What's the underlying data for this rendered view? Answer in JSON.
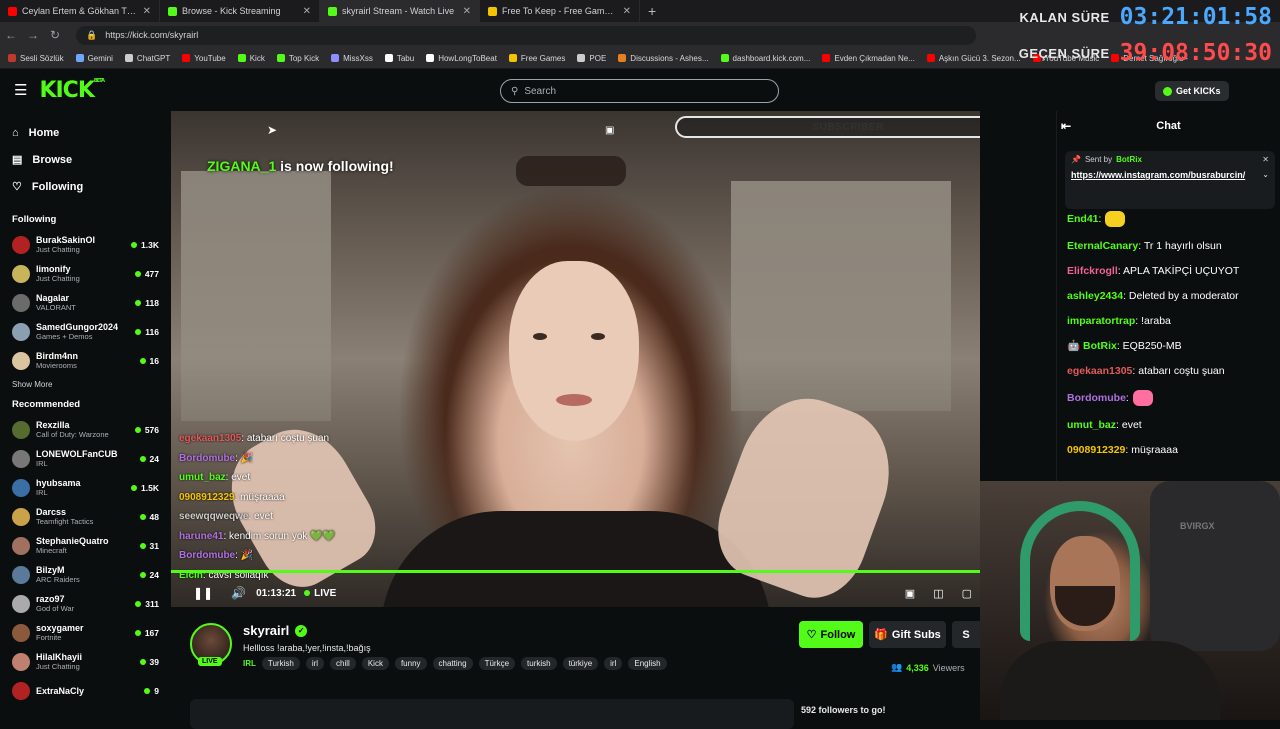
{
  "browser": {
    "tabs": [
      {
        "title": "Ceylan Ertem & Gökhan Türkmen",
        "icon_color": "#ff0000",
        "active": false
      },
      {
        "title": "Browse - Kick Streaming",
        "icon_color": "#53fc18",
        "active": false
      },
      {
        "title": "skyrairl Stream - Watch Live",
        "icon_color": "#53fc18",
        "active": true
      },
      {
        "title": "Free To Keep - Free Games, Every",
        "icon_color": "#f5c400",
        "active": false
      }
    ],
    "url": "https://kick.com/skyrairl",
    "bookmarks": [
      {
        "label": "Sesli Sözlük",
        "color": "#c0392b"
      },
      {
        "label": "Gemini",
        "color": "#6ea8ff"
      },
      {
        "label": "ChatGPT",
        "color": "#cccccc"
      },
      {
        "label": "YouTube",
        "color": "#ff0000"
      },
      {
        "label": "Kick",
        "color": "#53fc18"
      },
      {
        "label": "Top Kick",
        "color": "#53fc18"
      },
      {
        "label": "MissXss",
        "color": "#8e8eff"
      },
      {
        "label": "Tabu",
        "color": "#ffffff"
      },
      {
        "label": "HowLongToBeat",
        "color": "#ffffff"
      },
      {
        "label": "Free Games",
        "color": "#f5c400"
      },
      {
        "label": "POE",
        "color": "#cccccc"
      },
      {
        "label": "Discussions - Ashes...",
        "color": "#e67e22"
      },
      {
        "label": "dashboard.kick.com...",
        "color": "#53fc18"
      },
      {
        "label": "Evden Çıkmadan Ne...",
        "color": "#ff0000"
      },
      {
        "label": "Aşkın Gücü 3. Sezon...",
        "color": "#ff0000"
      },
      {
        "label": "YouTube Music",
        "color": "#ff0000"
      },
      {
        "label": "Demet Sağıroğlu -",
        "color": "#ff0000"
      }
    ]
  },
  "timer": {
    "remaining_label": "KALAN SÜRE",
    "remaining_value": "03:21:01:58",
    "elapsed_label": "GEÇEN SÜRE",
    "elapsed_value": "39:08:50:30"
  },
  "kick": {
    "logo": "KICK",
    "logo_sup": "BETA",
    "search_placeholder": "Search",
    "get_kicks": "Get KICKs"
  },
  "sidebar": {
    "nav": [
      {
        "label": "Home",
        "icon": "home-icon"
      },
      {
        "label": "Browse",
        "icon": "browse-icon"
      },
      {
        "label": "Following",
        "icon": "heart-icon"
      }
    ],
    "following_title": "Following",
    "following": [
      {
        "name": "BurakSakinOl",
        "category": "Just Chatting",
        "count": "1.3K",
        "color": "#b22222"
      },
      {
        "name": "limonify",
        "category": "Just Chatting",
        "count": "477",
        "color": "#c8b45a"
      },
      {
        "name": "Nagalar",
        "category": "VALORANT",
        "count": "118",
        "color": "#6b6b6b"
      },
      {
        "name": "SamedGungor2024",
        "category": "Games + Demos",
        "count": "116",
        "color": "#8aa0b0"
      },
      {
        "name": "Birdm4nn",
        "category": "Movierooms",
        "count": "16",
        "color": "#d9c6a0"
      }
    ],
    "show_more": "Show More",
    "recommended_title": "Recommended",
    "recommended": [
      {
        "name": "Rexzilla",
        "category": "Call of Duty: Warzone",
        "count": "576",
        "color": "#556b2f"
      },
      {
        "name": "LONEWOLFanCUB",
        "category": "IRL",
        "count": "24",
        "color": "#777777"
      },
      {
        "name": "hyubsama",
        "category": "IRL",
        "count": "1.5K",
        "color": "#3a6ea5"
      },
      {
        "name": "Darcss",
        "category": "Teamfight Tactics",
        "count": "48",
        "color": "#c9a24a"
      },
      {
        "name": "StephanieQuatro",
        "category": "Minecraft",
        "count": "31",
        "color": "#a07060"
      },
      {
        "name": "BilzyM",
        "category": "ARC Raiders",
        "count": "24",
        "color": "#5a7a9a"
      },
      {
        "name": "razo97",
        "category": "God of War",
        "count": "311",
        "color": "#aaaaaa"
      },
      {
        "name": "soxygamer",
        "category": "Fortnite",
        "count": "167",
        "color": "#8b5a3c"
      },
      {
        "name": "HilalKhayii",
        "category": "Just Chatting",
        "count": "39",
        "color": "#c08070"
      },
      {
        "name": "ExtraNaCly",
        "category": "",
        "count": "9",
        "color": "#b22222"
      }
    ]
  },
  "player": {
    "follow_notice_name": "ZIGANA_1",
    "follow_notice_text": "is now following!",
    "sub_goal_count": "2",
    "sub_goal_label": "SUBSCRIBER",
    "overlay_chat": [
      {
        "user": "egekaan1305",
        "text": ": atabarı coştu şuan",
        "color": "#e05a5a"
      },
      {
        "user": "Bordomube",
        "text": ": 🎉",
        "color": "#b070e0"
      },
      {
        "user": "umut_baz",
        "text": ": evet",
        "color": "#53fc18"
      },
      {
        "user": "0908912329",
        "text": ": müşraaaa",
        "color": "#f5c400"
      },
      {
        "user": "seewqqweqwe",
        "text": ": evet",
        "color": "#cccccc"
      },
      {
        "user": "harune41",
        "text": ": kendim sorun yok 💚💚",
        "color": "#b070e0"
      },
      {
        "user": "Bordomube",
        "text": ": 🎉",
        "color": "#b070e0"
      },
      {
        "user": "Elcin",
        "text": ": cavsı sollaqık",
        "color": "#53fc18"
      }
    ],
    "time": "01:13:21",
    "live_label": "LIVE"
  },
  "channel": {
    "name": "skyrairl",
    "live_badge": "LIVE",
    "title": "Hellloss !araba,!yer,!insta,!bağış",
    "category": "IRL",
    "tags": [
      "Turkish",
      "irl",
      "chill",
      "Kick",
      "funny",
      "chatting",
      "Türkçe",
      "turkish",
      "türkiye",
      "irl",
      "English"
    ],
    "follow_label": "Follow",
    "gift_label": "Gift Subs",
    "more_label": "S",
    "viewers_count": "4,336",
    "viewers_label": "Viewers",
    "goal_text": "592 followers to go!"
  },
  "chat": {
    "title": "Chat",
    "pinned_by_label": "Sent by",
    "pinned_by_user": "BotRix",
    "pinned_text": "https://www.instagram.com/busraburcin/",
    "messages": [
      {
        "user": "End41",
        "text": ":",
        "color": "#53fc18",
        "emote": "#f5d020"
      },
      {
        "user": "EternalCanary",
        "text": ": Tr 1 hayırlı olsun",
        "color": "#53fc18"
      },
      {
        "user": "Elifckrogll",
        "text": ": APLA TAKİPÇİ UÇUYOT",
        "color": "#f06292"
      },
      {
        "user": "ashley2434",
        "text": ": Deleted by a moderator",
        "color": "#53fc18"
      },
      {
        "user": "imparatortrap",
        "text": ": !araba",
        "color": "#53fc18"
      },
      {
        "user": "BotRix",
        "text": ": EQB250-MB",
        "color": "#53fc18"
      },
      {
        "user": "egekaan1305",
        "text": ": atabarı coştu şuan",
        "color": "#e05a5a"
      },
      {
        "user": "Bordomube",
        "text": ":",
        "color": "#b070e0",
        "emote": "#ff6fa0"
      },
      {
        "user": "umut_baz",
        "text": ": evet",
        "color": "#53fc18"
      },
      {
        "user": "0908912329",
        "text": ": müşraaaa",
        "color": "#f5c400"
      }
    ]
  },
  "webcam": {
    "chair_text": "BVIRGX"
  }
}
